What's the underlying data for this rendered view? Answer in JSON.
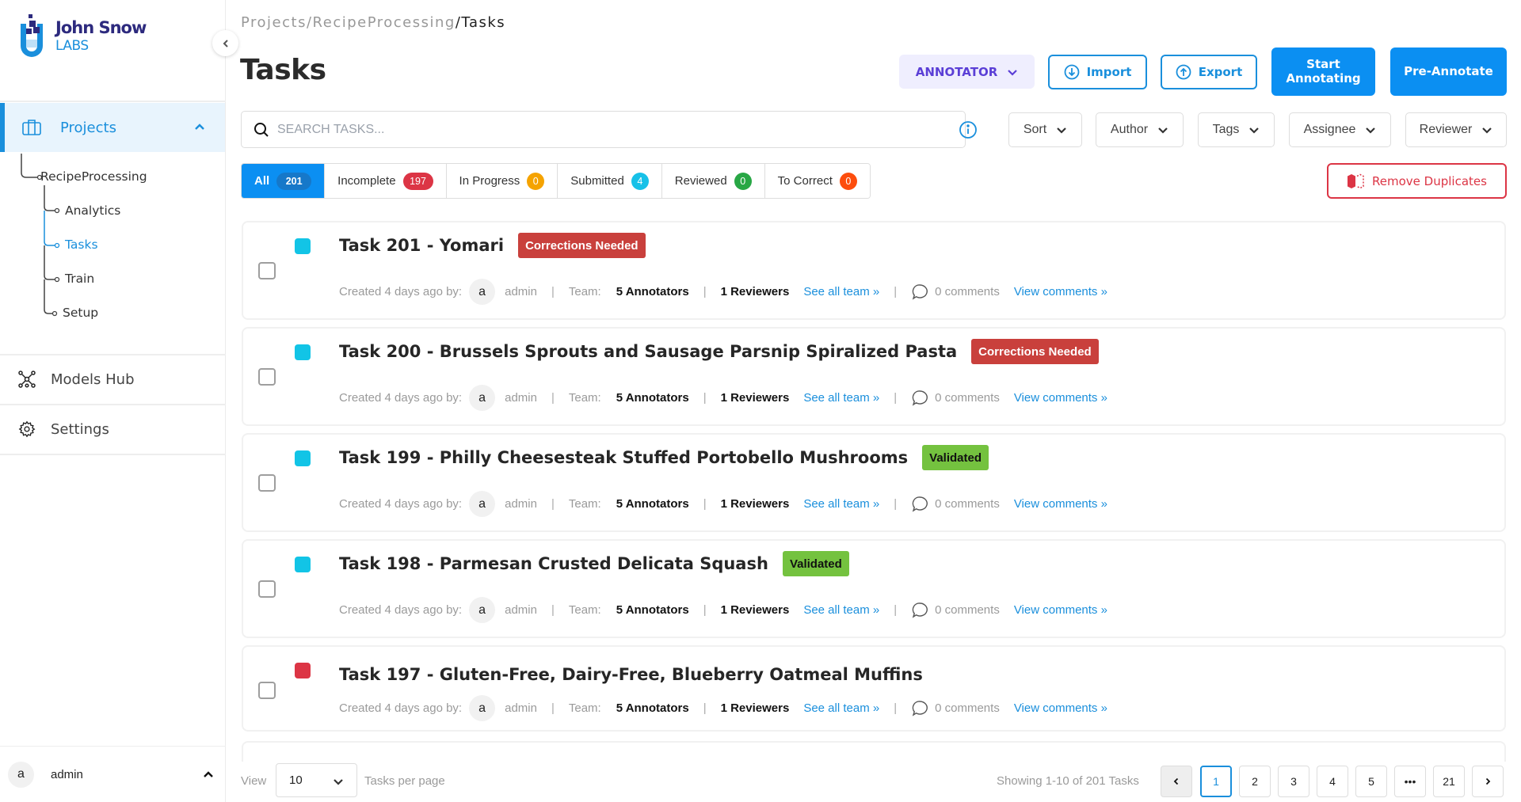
{
  "brand": {
    "line1": "John Snow",
    "line2": "LABS"
  },
  "sidebar": {
    "projects_label": "Projects",
    "tree": {
      "project": "RecipeProcessing",
      "children": [
        "Analytics",
        "Tasks",
        "Train",
        "Setup"
      ],
      "active": "Tasks"
    },
    "models_hub_label": "Models Hub",
    "settings_label": "Settings",
    "user": {
      "initial": "a",
      "name": "admin"
    }
  },
  "breadcrumb": {
    "items": [
      "Projects",
      "RecipeProcessing"
    ],
    "current": "Tasks",
    "separator": "/"
  },
  "header": {
    "title": "Tasks",
    "role_label": "ANNOTATOR",
    "import_label": "Import",
    "export_label": "Export",
    "start_annotating_line1": "Start",
    "start_annotating_line2": "Annotating",
    "pre_annotate_label": "Pre-Annotate"
  },
  "search": {
    "placeholder": "SEARCH TASKS...",
    "value": ""
  },
  "filters": [
    "Sort",
    "Author",
    "Tags",
    "Assignee",
    "Reviewer"
  ],
  "tabs": [
    {
      "label": "All",
      "count": "201",
      "color": "#1678c9",
      "active": true
    },
    {
      "label": "Incomplete",
      "count": "197",
      "color": "#dc3545"
    },
    {
      "label": "In Progress",
      "count": "0",
      "color": "#f5a300"
    },
    {
      "label": "Submitted",
      "count": "4",
      "color": "#17c1e8"
    },
    {
      "label": "Reviewed",
      "count": "0",
      "color": "#28a745"
    },
    {
      "label": "To Correct",
      "count": "0",
      "color": "#fd4d0d"
    }
  ],
  "remove_duplicates_label": "Remove Duplicates",
  "tasks": [
    {
      "title": "Task 201 - Yomari",
      "status": "Corrections Needed",
      "status_type": "corr",
      "color": "#12c4e6",
      "created": "Created 4 days ago by:",
      "author_initial": "a",
      "author": "admin",
      "team_label": "Team:",
      "annotators": "5 Annotators",
      "reviewers": "1 Reviewers",
      "see_team": "See all team »",
      "comments": "0 comments",
      "view_comments": "View comments »"
    },
    {
      "title": "Task 200 - Brussels Sprouts and Sausage Parsnip Spiralized Pasta",
      "status": "Corrections Needed",
      "status_type": "corr",
      "color": "#12c4e6",
      "created": "Created 4 days ago by:",
      "author_initial": "a",
      "author": "admin",
      "team_label": "Team:",
      "annotators": "5 Annotators",
      "reviewers": "1 Reviewers",
      "see_team": "See all team »",
      "comments": "0 comments",
      "view_comments": "View comments »"
    },
    {
      "title": "Task 199 - Philly Cheesesteak Stuffed Portobello Mushrooms",
      "status": "Validated",
      "status_type": "valid",
      "color": "#12c4e6",
      "created": "Created 4 days ago by:",
      "author_initial": "a",
      "author": "admin",
      "team_label": "Team:",
      "annotators": "5 Annotators",
      "reviewers": "1 Reviewers",
      "see_team": "See all team »",
      "comments": "0 comments",
      "view_comments": "View comments »"
    },
    {
      "title": "Task 198 - Parmesan Crusted Delicata Squash",
      "status": "Validated",
      "status_type": "valid",
      "color": "#12c4e6",
      "created": "Created 4 days ago by:",
      "author_initial": "a",
      "author": "admin",
      "team_label": "Team:",
      "annotators": "5 Annotators",
      "reviewers": "1 Reviewers",
      "see_team": "See all team »",
      "comments": "0 comments",
      "view_comments": "View comments »"
    },
    {
      "title": "Task 197 - Gluten-Free, Dairy-Free, Blueberry Oatmeal Muffins",
      "status": "",
      "status_type": "",
      "color": "#dc3545",
      "created": "Created 4 days ago by:",
      "author_initial": "a",
      "author": "admin",
      "team_label": "Team:",
      "annotators": "5 Annotators",
      "reviewers": "1 Reviewers",
      "see_team": "See all team »",
      "comments": "0 comments",
      "view_comments": "View comments »"
    }
  ],
  "footer": {
    "view_label": "View",
    "per_page": "10",
    "per_page_label": "Tasks per page",
    "showing": "Showing 1-10 of 201 Tasks",
    "pages": [
      "1",
      "2",
      "3",
      "4",
      "5",
      "•••",
      "21"
    ],
    "current_page": "1"
  }
}
